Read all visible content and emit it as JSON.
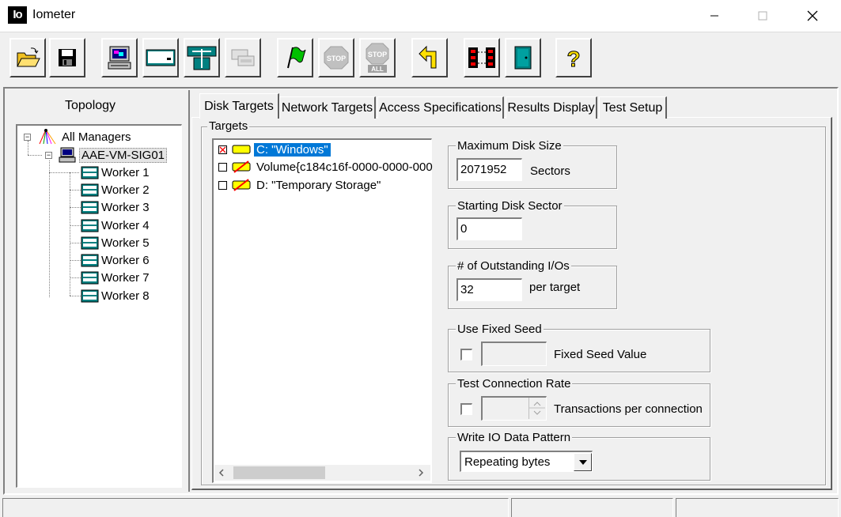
{
  "window": {
    "logo": "Io",
    "title": "Iometer"
  },
  "toolbar": {
    "buttons": [
      {
        "name": "open-config-button",
        "icon": "open-folder-icon"
      },
      {
        "name": "save-config-button",
        "icon": "floppy-disk-icon"
      },
      {
        "name": "start-manager-button",
        "icon": "computer-icon"
      },
      {
        "name": "start-disk-worker-button",
        "icon": "disk-worker-icon"
      },
      {
        "name": "start-network-worker-button",
        "icon": "network-worker-icon"
      },
      {
        "name": "duplicate-worker-button",
        "icon": "duplicate-icon"
      },
      {
        "name": "start-tests-button",
        "icon": "green-flag-icon"
      },
      {
        "name": "stop-button",
        "icon": "stop-icon",
        "label": "STOP"
      },
      {
        "name": "stop-all-button",
        "icon": "stop-all-icon",
        "label": "STOP",
        "label2": "ALL"
      },
      {
        "name": "reset-workers-button",
        "icon": "reset-arrow-icon"
      },
      {
        "name": "disconnect-managers-button",
        "icon": "disconnect-icon"
      },
      {
        "name": "exit-button",
        "icon": "exit-door-icon"
      },
      {
        "name": "about-button",
        "icon": "question-icon",
        "label": "?"
      }
    ]
  },
  "topology": {
    "title": "Topology",
    "root": "All Managers",
    "manager": "AAE-VM-SIG01",
    "workers": [
      "Worker 1",
      "Worker 2",
      "Worker 3",
      "Worker 4",
      "Worker 5",
      "Worker 6",
      "Worker 7",
      "Worker 8"
    ]
  },
  "tabs": [
    "Disk Targets",
    "Network Targets",
    "Access Specifications",
    "Results Display",
    "Test Setup"
  ],
  "targets": {
    "title": "Targets",
    "items": [
      {
        "label": "C: \"Windows\"",
        "checked": true,
        "selected": true
      },
      {
        "label": "Volume{c184c16f-0000-0000-000",
        "checked": false,
        "selected": false
      },
      {
        "label": "D: \"Temporary Storage\"",
        "checked": false,
        "selected": false
      }
    ]
  },
  "max_disk_size": {
    "title": "Maximum Disk Size",
    "value": "2071952",
    "unit": "Sectors"
  },
  "starting_sector": {
    "title": "Starting Disk Sector",
    "value": "0"
  },
  "outstanding_ios": {
    "title": "# of Outstanding I/Os",
    "value": "32",
    "unit": "per target"
  },
  "fixed_seed": {
    "title": "Use Fixed Seed",
    "value": "",
    "label": "Fixed Seed Value"
  },
  "connection_rate": {
    "title": "Test Connection Rate",
    "value": "",
    "label": "Transactions per connection"
  },
  "write_pattern": {
    "title": "Write IO Data Pattern",
    "selected": "Repeating bytes"
  }
}
